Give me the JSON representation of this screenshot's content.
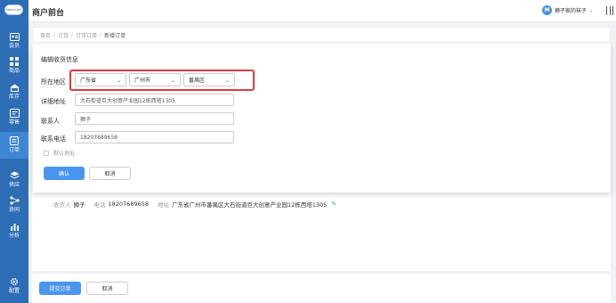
{
  "sidebar": {
    "logo_text": "MERCHANT",
    "items": [
      {
        "label": "会员",
        "icon": "member-card-icon"
      },
      {
        "label": "商品",
        "icon": "grid-icon"
      },
      {
        "label": "库存",
        "icon": "warehouse-icon"
      },
      {
        "label": "零售",
        "icon": "retail-icon"
      },
      {
        "label": "订单",
        "icon": "order-list-icon"
      },
      {
        "label": "供应",
        "icon": "layers-icon"
      },
      {
        "label": "协同",
        "icon": "network-icon"
      },
      {
        "label": "分析",
        "icon": "chart-icon"
      },
      {
        "label": "配置",
        "icon": "gear-icon"
      }
    ],
    "active_index": 4
  },
  "header": {
    "title": "商户前台",
    "user_initial": "M",
    "user_name": "狮子家的袜子",
    "user_caret": "⌄"
  },
  "breadcrumb": [
    "首页",
    "订货",
    "订货订单",
    "新增订单"
  ],
  "breadcrumb_sep": "/",
  "modal": {
    "title": "编辑收货信息",
    "region_label": "所在地区",
    "province": "广东省",
    "city": "广州市",
    "district": "番禺区",
    "address_label": "详细地址",
    "address_value": "大石街道巨大创意产业园12栋西塔1305",
    "contact_label": "联系人",
    "contact_value": "狮子",
    "phone_label": "联系电话",
    "phone_value": "18207689658",
    "default_label": "默认地址",
    "confirm_label": "确认",
    "cancel_label": "取消"
  },
  "receiver": {
    "name_label": "收货人",
    "name_value": "狮子",
    "phone_label": "电话",
    "phone_value": "18207689658",
    "address_label": "地址",
    "address_value": "广东省广州市番禺区大石街道巨大创意产业园12栋西塔1305"
  },
  "footer": {
    "submit_label": "提交订单",
    "cancel_label": "取消"
  },
  "colors": {
    "sidebar": "#2d6db5",
    "sidebar_active": "#3e86d6",
    "primary": "#4a95f0",
    "highlight": "#e03a3a"
  }
}
